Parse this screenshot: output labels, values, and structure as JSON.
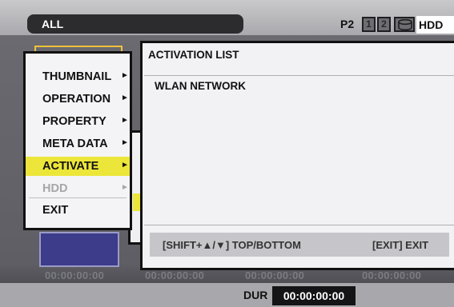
{
  "topbar": {
    "mode": "ALL",
    "media_label": "P2",
    "slots": [
      "1",
      "2"
    ],
    "storage_label": "HDD"
  },
  "menu": {
    "items": [
      {
        "label": "THUMBNAIL",
        "arrow": "►"
      },
      {
        "label": "OPERATION",
        "arrow": "►"
      },
      {
        "label": "PROPERTY",
        "arrow": "►"
      },
      {
        "label": "META DATA",
        "arrow": "►"
      },
      {
        "label": "ACTIVATE",
        "arrow": "►",
        "selected": true
      },
      {
        "label": "HDD",
        "arrow": "►",
        "disabled": true
      },
      {
        "label": "EXIT"
      }
    ]
  },
  "activation_panel": {
    "title": "ACTIVATION LIST",
    "items": [
      "WLAN NETWORK"
    ],
    "footer_left": "[SHIFT+▲/▼] TOP/BOTTOM",
    "footer_right": "[EXIT] EXIT"
  },
  "timecodes": [
    "00:00:00:00",
    "00:00:00:00",
    "00:00:00:00",
    "00:00:00:00"
  ],
  "bottombar": {
    "dur_label": "DUR",
    "dur_value": "00:00:00:00"
  },
  "colors": {
    "highlight": "#ece63a",
    "thumb_selected_border": "#f0c23c",
    "thumb_clip": "#3c3c8a"
  }
}
